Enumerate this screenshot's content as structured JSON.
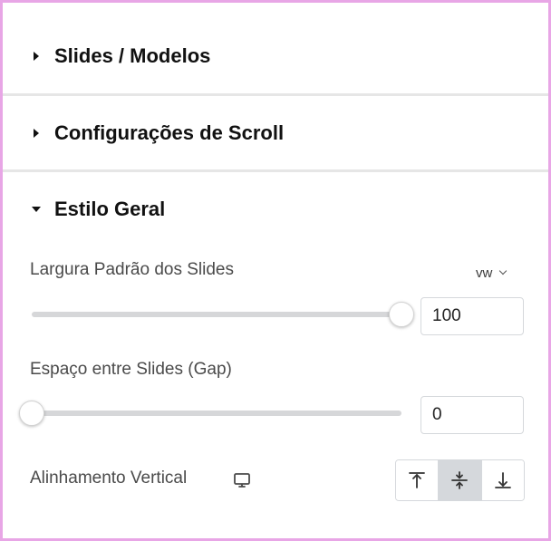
{
  "sections": [
    {
      "title": "Slides / Modelos",
      "expanded": false
    },
    {
      "title": "Configurações de Scroll",
      "expanded": false
    },
    {
      "title": "Estilo Geral",
      "expanded": true
    }
  ],
  "controls": {
    "width": {
      "label": "Largura Padrão dos Slides",
      "unit": "vw",
      "value": "100",
      "slider_fraction": 1.0
    },
    "gap": {
      "label": "Espaço entre Slides (Gap)",
      "value": "0",
      "slider_fraction": 0.0
    },
    "vertical_alignment": {
      "label": "Alinhamento Vertical",
      "responsive_icon": "desktop-monitor-icon",
      "options": [
        "align-top-icon",
        "align-middle-icon",
        "align-bottom-icon"
      ],
      "selected": "align-middle-icon"
    }
  },
  "colors": {
    "frame_border": "#e8a6e6",
    "divider": "#e6e6e6",
    "track": "#d6d7d9",
    "active_button": "#d5d8dc"
  }
}
